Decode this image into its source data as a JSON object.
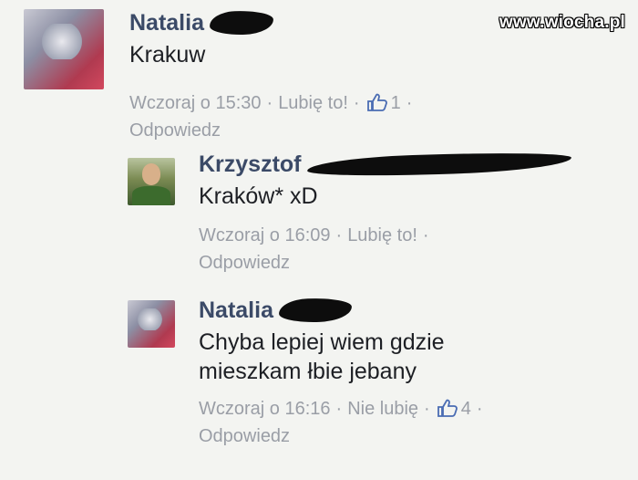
{
  "watermark": "www.wiocha.pl",
  "comments": [
    {
      "author": "Natalia",
      "text_lines": [
        "Krakuw"
      ],
      "time": "Wczoraj o 15:30",
      "like_label": "Lubię to!",
      "likes": "1",
      "reply_label": "Odpowiedz",
      "has_like_count": true
    },
    {
      "author": "Krzysztof",
      "text_lines": [
        "Kraków* xD"
      ],
      "time": "Wczoraj o 16:09",
      "like_label": "Lubię to!",
      "likes": "",
      "reply_label": "Odpowiedz",
      "has_like_count": false
    },
    {
      "author": "Natalia",
      "text_lines": [
        "Chyba lepiej wiem gdzie",
        "mieszkam łbie jebany"
      ],
      "time": "Wczoraj o 16:16",
      "like_label": "Nie lubię",
      "likes": "4",
      "reply_label": "Odpowiedz",
      "has_like_count": true
    }
  ],
  "colors": {
    "name": "#3b4a67",
    "meta": "#9a9ea6",
    "like_icon": "#4a6cb3",
    "redaction": "#0d0d0d"
  }
}
